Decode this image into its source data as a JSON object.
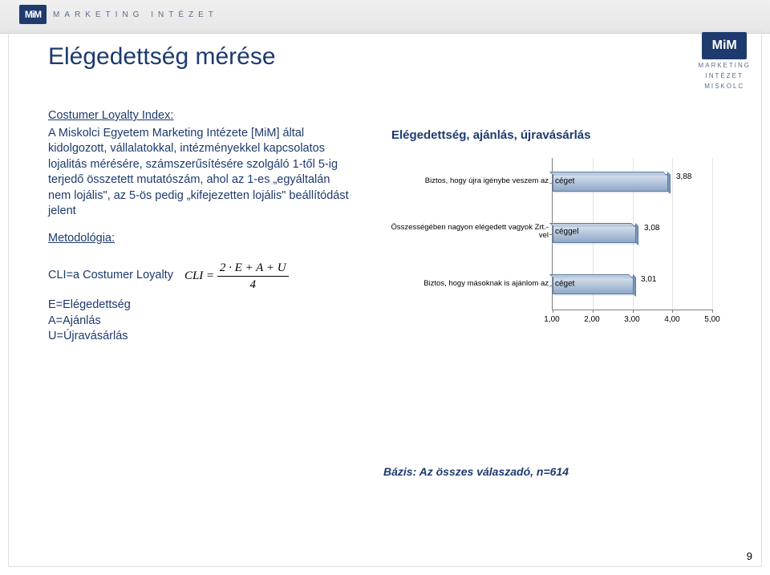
{
  "header": {
    "brand_badge": "MiM",
    "brand_text": "MARKETING INTÉZET"
  },
  "logo_right": {
    "badge": "MiM",
    "line1": "MARKETING",
    "line2": "INTÉZET",
    "line3": "MISKOLC"
  },
  "title": "Elégedettség mérése",
  "left": {
    "subhead": "Costumer Loyalty Index:",
    "para": "A Miskolci Egyetem Marketing Intézete [MiM] által kidolgozott, vállalatokkal, intézményekkel kapcsolatos lojalitás mérésére, számszerűsítésére szolgáló 1-től 5-ig terjedő összetett mutatószám, ahol az 1-es „egyáltalán nem lojális\", az 5-ös pedig „kifejezetten lojális\" beállítódást jelent",
    "met": "Metodológia:",
    "formula_lhs": "CLI",
    "formula_eq": "=",
    "formula_num": "2 · E + A + U",
    "formula_den": "4",
    "def1": "CLI=a Costumer Loyalty",
    "def2": "E=Elégedettség",
    "def3": "A=Ajánlás",
    "def4": "U=Újravásárlás"
  },
  "chart_data": {
    "type": "bar",
    "orientation": "horizontal",
    "title": "Elégedettség, ajánlás, újravásárlás",
    "xlabel": "",
    "ylabel": "",
    "xlim": [
      1.0,
      5.0
    ],
    "xticks": [
      1.0,
      2.0,
      3.0,
      4.0,
      5.0
    ],
    "categories_left": [
      "Biztos, hogy újra igénybe veszem az",
      "Összességében nagyon elégedett vagyok Zrt.-vel",
      "Biztos, hogy másoknak is ajánlom az"
    ],
    "categories_right": [
      "céget",
      "céggel",
      "céget"
    ],
    "values": [
      3.88,
      3.08,
      3.01
    ]
  },
  "footnote": "Bázis: Az összes válaszadó, n=614",
  "page_number": "9"
}
